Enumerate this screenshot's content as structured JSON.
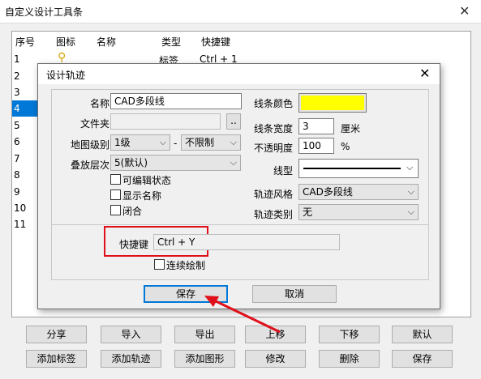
{
  "outer": {
    "title": "自定义设计工具条",
    "close": "✕"
  },
  "list": {
    "headers": [
      "序号",
      "图标",
      "名称",
      "类型",
      "快捷键"
    ],
    "rows": [
      "1",
      "2",
      "3",
      "4",
      "5",
      "6",
      "7",
      "8",
      "9",
      "10",
      "11"
    ],
    "row1": {
      "type": "标签",
      "shortcut": "Ctrl + 1"
    }
  },
  "buttons": {
    "row1": [
      "分享",
      "导入",
      "导出",
      "上移",
      "下移",
      "默认"
    ],
    "row2": [
      "添加标签",
      "添加轨迹",
      "添加图形",
      "修改",
      "删除",
      "保存"
    ]
  },
  "dialog": {
    "title": "设计轨迹",
    "close": "✕",
    "name_label": "名称",
    "name_value": "CAD多段线",
    "folder_label": "文件夹",
    "folder_btn": "..",
    "map_level_label": "地图级别",
    "map_level_value": "1级",
    "dash": "-",
    "map_level_max": "不限制",
    "stack_label": "叠放层次",
    "stack_value": "5(默认)",
    "cb_editable": "可编辑状态",
    "cb_showname": "显示名称",
    "cb_closed": "闭合",
    "color_label": "线条颜色",
    "color_value": "#ffff00",
    "width_label": "线条宽度",
    "width_value": "3",
    "width_unit": "厘米",
    "opacity_label": "不透明度",
    "opacity_value": "100",
    "opacity_unit": "%",
    "linetype_label": "线型",
    "style_label": "轨迹风格",
    "style_value": "CAD多段线",
    "category_label": "轨迹类别",
    "category_value": "无",
    "shortcut_label": "快捷键",
    "shortcut_value": "Ctrl + Y",
    "cb_continuous": "连续绘制",
    "save": "保存",
    "cancel": "取消"
  }
}
